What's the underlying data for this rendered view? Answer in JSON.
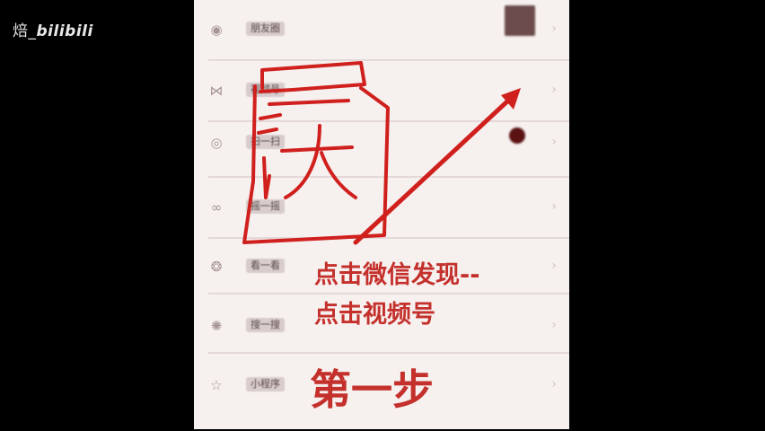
{
  "watermark": {
    "prefix": "焙_",
    "brand": "bilibili"
  },
  "settings_list": {
    "rows": [
      {
        "icon": "moments-icon",
        "label": "朋友圈",
        "has_thumbnail": true
      },
      {
        "icon": "channels-icon",
        "label": "视频号",
        "has_red_dot": true
      },
      {
        "icon": "scan-icon",
        "label": "扫一扫"
      },
      {
        "icon": "shake-icon",
        "label": "摇一摇"
      },
      {
        "icon": "look-icon",
        "label": "看一看"
      },
      {
        "icon": "search-icon",
        "label": "搜一搜"
      },
      {
        "icon": "star-icon",
        "label": "小程序"
      }
    ]
  },
  "annotations": {
    "line1": "点击微信发现--",
    "line2": "点击视频号",
    "step": "第一步",
    "drawn": "大",
    "color": "#d0201d"
  }
}
